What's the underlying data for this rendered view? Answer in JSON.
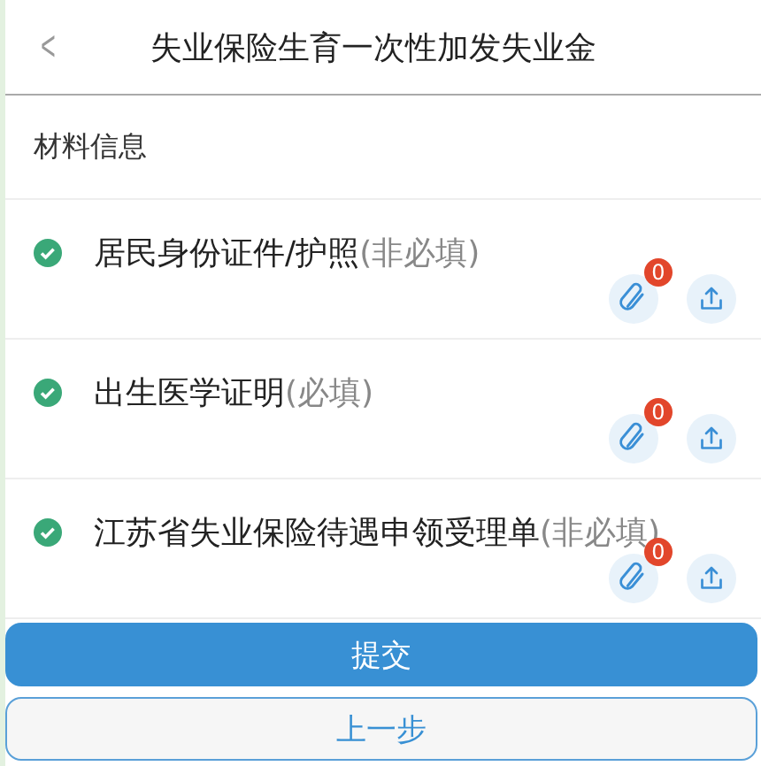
{
  "header": {
    "back": "<",
    "title": "失业保险生育一次性加发失业金"
  },
  "section": {
    "title": "材料信息"
  },
  "materials": [
    {
      "name": "居民身份证件/护照",
      "note": "(非必填)",
      "done": true,
      "count": "0"
    },
    {
      "name": "出生医学证明",
      "note": "(必填)",
      "done": true,
      "count": "0"
    },
    {
      "name": "江苏省失业保险待遇申领受理单",
      "note": "(非必填)",
      "done": true,
      "count": "0"
    }
  ],
  "buttons": [
    {
      "label": "提交",
      "kind": "primary"
    },
    {
      "label": "上一步",
      "kind": "secondary"
    }
  ]
}
